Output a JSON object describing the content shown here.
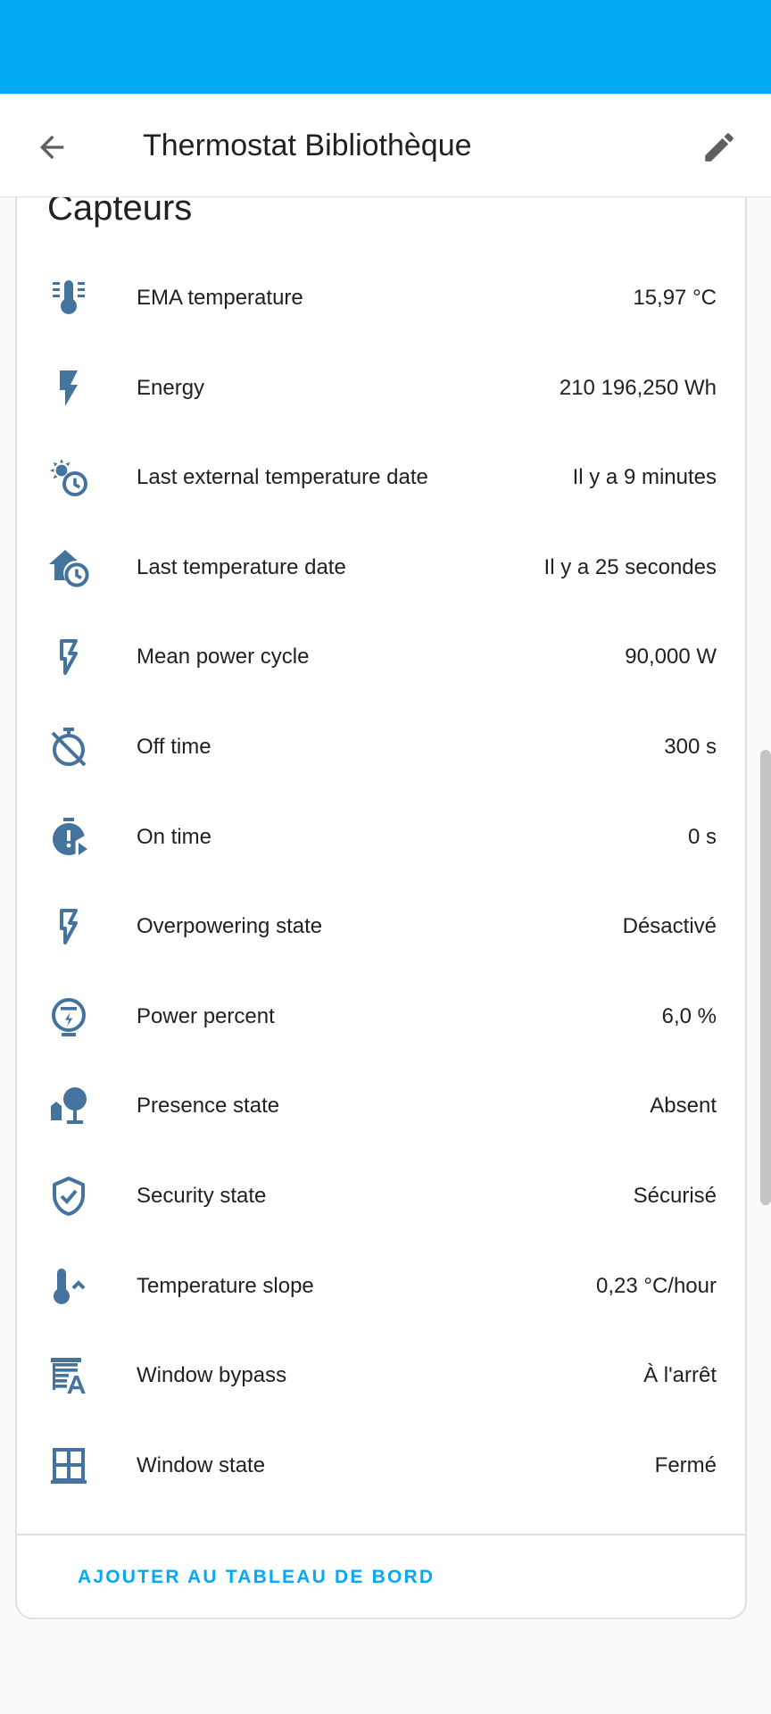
{
  "header": {
    "title": "Thermostat Bibliothèque",
    "back_icon": "arrow-left-icon",
    "edit_icon": "pencil-icon"
  },
  "card": {
    "title": "Capteurs",
    "rows": [
      {
        "icon": "thermometer-lines-icon",
        "label": "EMA temperature",
        "value": "15,97 °C"
      },
      {
        "icon": "flash-icon",
        "label": "Energy",
        "value": "210 196,250 Wh"
      },
      {
        "icon": "sun-clock-icon",
        "label": "Last external temperature date",
        "value": "Il y a 9 minutes"
      },
      {
        "icon": "home-clock-icon",
        "label": "Last temperature date",
        "value": "Il y a 25 secondes"
      },
      {
        "icon": "flash-outline-icon",
        "label": "Mean power cycle",
        "value": "90,000 W"
      },
      {
        "icon": "timer-off-icon",
        "label": "Off time",
        "value": "300 s"
      },
      {
        "icon": "timer-play-icon",
        "label": "On time",
        "value": "0 s"
      },
      {
        "icon": "flash-outline-icon",
        "label": "Overpowering state",
        "value": "Désactivé"
      },
      {
        "icon": "meter-electric-icon",
        "label": "Power percent",
        "value": "6,0 %"
      },
      {
        "icon": "home-tree-icon",
        "label": "Presence state",
        "value": "Absent"
      },
      {
        "icon": "shield-check-icon",
        "label": "Security state",
        "value": "Sécurisé"
      },
      {
        "icon": "thermometer-chevron-up-icon",
        "label": "Temperature slope",
        "value": "0,23 °C/hour"
      },
      {
        "icon": "window-shutter-auto-icon",
        "label": "Window bypass",
        "value": "À l'arrêt"
      },
      {
        "icon": "window-closed-variant-icon",
        "label": "Window state",
        "value": "Fermé"
      }
    ],
    "add_button": "AJOUTER AU TABLEAU DE BORD"
  },
  "colors": {
    "status_bar": "#03a9f4",
    "icon": "#44739e",
    "accent": "#03a9f4"
  }
}
